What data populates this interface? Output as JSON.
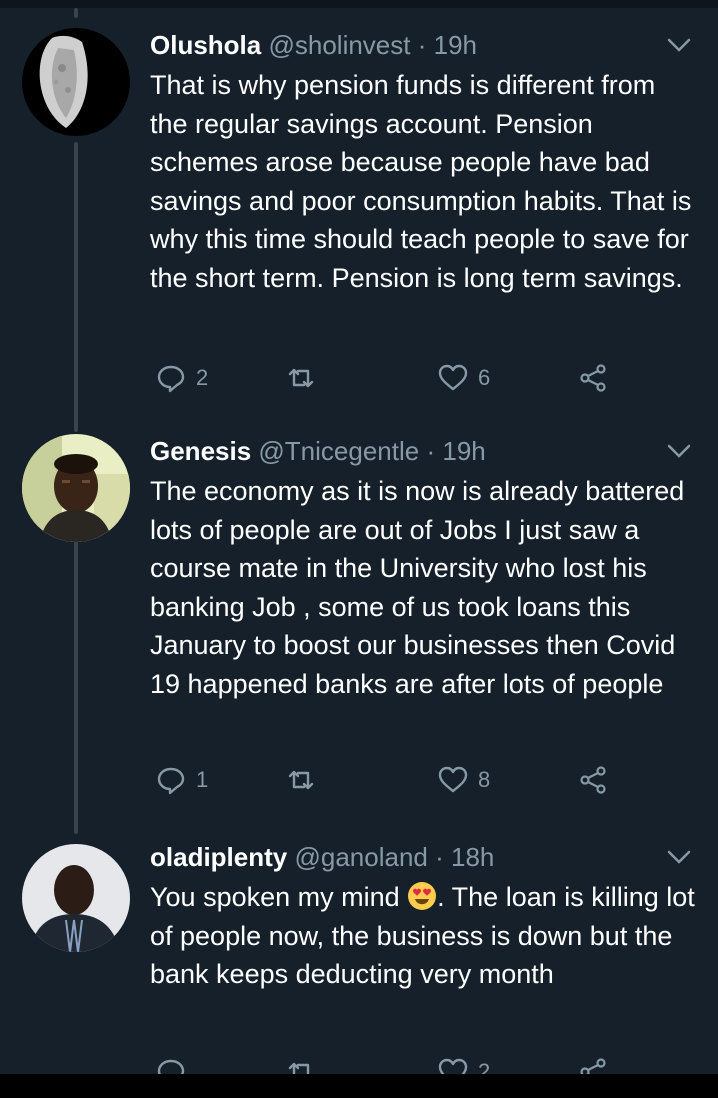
{
  "tweets": [
    {
      "name": "Olushola",
      "handle": "@sholinvest",
      "dot": "·",
      "time": "19h",
      "text": "That is why pension funds is different from the regular savings account. Pension schemes arose because people have bad savings and poor consumption habits. That is why this time should teach people to save for the short term. Pension is long term savings.",
      "replies": "2",
      "retweets": "",
      "likes": "6"
    },
    {
      "name": "Genesis",
      "handle": "@Tnicegentle",
      "dot": "·",
      "time": "19h",
      "text": "The economy as it is now is already battered lots of people are out of Jobs I just saw a course mate in the University who lost his banking Job , some of us took loans this January to boost our businesses then Covid 19 happened banks are after lots of people",
      "replies": "1",
      "retweets": "",
      "likes": "8"
    },
    {
      "name": "oladiplenty",
      "handle": "@ganoland",
      "dot": "·",
      "time": "18h",
      "text_before_emoji": "You spoken my mind ",
      "emoji": "smiling-face-with-heart-eyes",
      "text_after_emoji": ". The loan is killing lot of people now, the business is down but the bank keeps deducting very month",
      "replies": "",
      "retweets": "",
      "likes": "2"
    }
  ],
  "icons": {
    "reply": "reply-icon",
    "retweet": "retweet-icon",
    "like": "heart-icon",
    "share": "share-icon",
    "more": "chevron-down-icon"
  },
  "colors": {
    "background": "#15202b",
    "secondary_text": "#8899a6",
    "thread_line": "#38444d"
  }
}
